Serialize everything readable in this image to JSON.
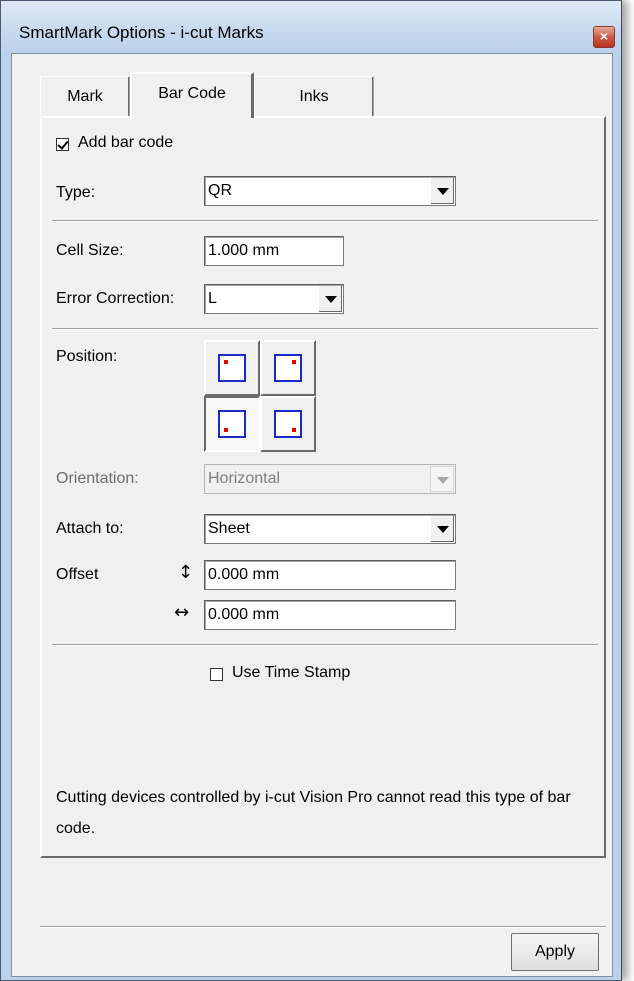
{
  "window": {
    "title": "SmartMark Options - i-cut Marks",
    "close_label": "×"
  },
  "tabs": [
    {
      "label": "Mark",
      "active": false
    },
    {
      "label": "Bar Code",
      "active": true
    },
    {
      "label": "Inks",
      "active": false
    }
  ],
  "barcode": {
    "add_bar_code": {
      "label": "Add bar code",
      "checked": true
    },
    "type": {
      "label": "Type:",
      "value": "QR"
    },
    "cell_size": {
      "label": "Cell Size:",
      "value": "1.000 mm"
    },
    "error_correction": {
      "label": "Error Correction:",
      "value": "L"
    },
    "position": {
      "label": "Position:",
      "selected": "bottom-left"
    },
    "orientation": {
      "label": "Orientation:",
      "value": "Horizontal",
      "disabled": true
    },
    "attach_to": {
      "label": "Attach to:",
      "value": "Sheet"
    },
    "offset": {
      "label": "Offset",
      "vertical_icon": "↕",
      "vertical_value": "0.000 mm",
      "horizontal_icon": "↔",
      "horizontal_value": "0.000 mm"
    },
    "time_stamp": {
      "label": "Use Time Stamp",
      "checked": false
    },
    "note": "Cutting devices controlled by i-cut Vision Pro cannot read this type of bar code."
  },
  "footer": {
    "apply_label": "Apply"
  },
  "colors": {
    "frame": "#b9d1ea",
    "dialog_bg": "#f0f0f0",
    "position_square": "#1b2bc4",
    "position_dot": "#ee0000"
  }
}
